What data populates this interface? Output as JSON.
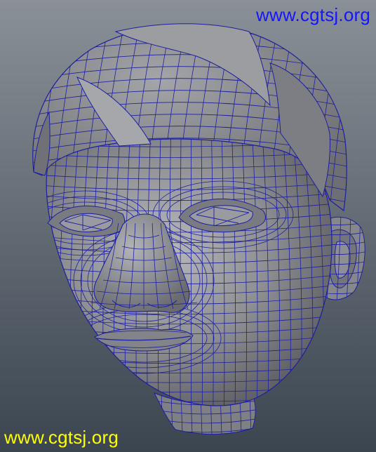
{
  "viewport": {
    "background_top": "#8a9097",
    "background_bottom": "#3b4550",
    "mesh_fill": "#8e8f93",
    "mesh_shadow": "#5c5d62",
    "mesh_highlight": "#b7b8bc",
    "wire_color": "#1d1f9e"
  },
  "watermarks": {
    "top": "www.cgtsj.org",
    "bottom": "www.cgtsj.org",
    "top_color": "#1515ff",
    "bottom_color": "#ffff00"
  }
}
